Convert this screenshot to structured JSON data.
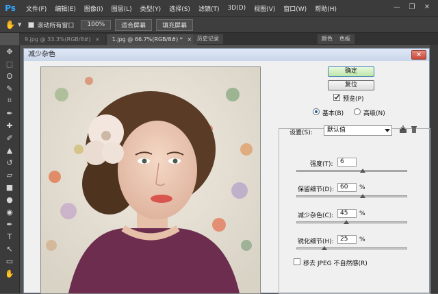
{
  "app": {
    "logo": "Ps"
  },
  "menus": [
    "文件(F)",
    "编辑(E)",
    "图像(I)",
    "图层(L)",
    "类型(Y)",
    "选择(S)",
    "滤镜(T)",
    "3D(D)",
    "视图(V)",
    "窗口(W)",
    "帮助(H)"
  ],
  "window_controls": {
    "minimize": "—",
    "restore": "❐",
    "close": "✕"
  },
  "options_bar": {
    "scroll_all": "滚动所有窗口",
    "zoom_100": "100%",
    "fit_screen": "适合屏幕",
    "fill_screen": "填充屏幕"
  },
  "doc_tabs": [
    {
      "label": "9.jpg @ 33.3%(RGB/8#)",
      "close": "×"
    },
    {
      "label": "1.jpg @ 66.7%(RGB/8#) *",
      "close": "×"
    }
  ],
  "panel_tabs": [
    "历史记录",
    "颜色",
    "色板"
  ],
  "dialog": {
    "title": "减少杂色",
    "close": "✕",
    "ok": "确定",
    "reset": "复位",
    "preview": "预览(P)",
    "mode_basic": "基本(B)",
    "mode_advanced": "高级(N)",
    "settings_label": "设置(S):",
    "settings_value": "默认值",
    "percent": "%",
    "strength": {
      "label": "强度(T):",
      "value": "6",
      "slider": 0.6
    },
    "preserve_details": {
      "label": "保留细节(D):",
      "value": "60",
      "slider": 0.6
    },
    "reduce_color_noise": {
      "label": "减少杂色(C):",
      "value": "45",
      "slider": 0.45
    },
    "sharpen_details": {
      "label": "锐化细节(H):",
      "value": "25",
      "slider": 0.25
    },
    "remove_jpeg": "移去 JPEG 不自然感(R)"
  }
}
